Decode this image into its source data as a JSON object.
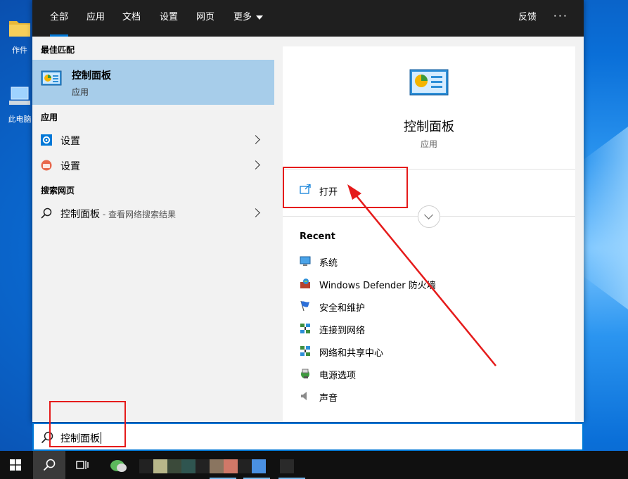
{
  "desktop": {
    "icons": [
      {
        "label": "作件",
        "icon": "folder-icon"
      },
      {
        "label": "此电脑",
        "icon": "computer-icon"
      }
    ]
  },
  "tabs": [
    {
      "label": "全部",
      "active": true
    },
    {
      "label": "应用"
    },
    {
      "label": "文档"
    },
    {
      "label": "设置"
    },
    {
      "label": "网页"
    },
    {
      "label": "更多"
    }
  ],
  "header": {
    "feedback": "反馈",
    "more_options": "···"
  },
  "left": {
    "best_match_heading": "最佳匹配",
    "best_match": {
      "title": "控制面板",
      "subtitle": "应用",
      "icon": "control-panel-icon"
    },
    "apps_heading": "应用",
    "apps": [
      {
        "label": "设置",
        "icon": "gear-icon"
      },
      {
        "label": "设置",
        "icon": "settings-app-icon"
      }
    ],
    "web_heading": "搜索网页",
    "web": {
      "label": "控制面板",
      "suffix": " - 查看网络搜索结果",
      "icon": "search-icon"
    }
  },
  "right": {
    "title": "控制面板",
    "subtitle": "应用",
    "open_action": "打开",
    "recent_heading": "Recent",
    "recent": [
      {
        "label": "系统",
        "icon": "system-icon"
      },
      {
        "label": "Windows Defender 防火墙",
        "icon": "firewall-icon"
      },
      {
        "label": "安全和维护",
        "icon": "flag-icon"
      },
      {
        "label": "连接到网络",
        "icon": "network-icon"
      },
      {
        "label": "网络和共享中心",
        "icon": "network-icon"
      },
      {
        "label": "电源选项",
        "icon": "power-icon"
      },
      {
        "label": "声音",
        "icon": "speaker-icon"
      }
    ]
  },
  "search": {
    "value": "控制面板"
  },
  "colors": {
    "accent": "#0078d7",
    "selection": "#a7cdea",
    "annotation": "#e51b1b",
    "topbar": "#1f1f1f"
  }
}
